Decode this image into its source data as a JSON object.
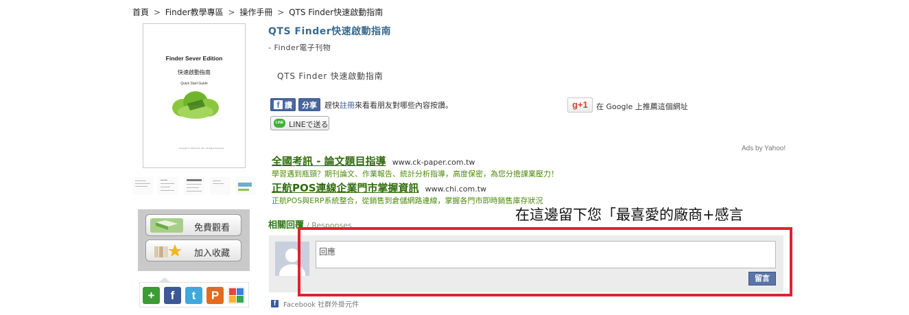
{
  "breadcrumb": {
    "items": [
      "首頁",
      "Finder教學專區",
      "操作手冊",
      "QTS Finder快速啟動指南"
    ],
    "separator": ">"
  },
  "cover": {
    "title": "Finder Sever Edition",
    "subtitle": "快速啟動指南",
    "guide": "Quick Start Guide",
    "footer": "Copyright © 2009 QTS, INC. All Rights Reserved."
  },
  "actions": {
    "free_view": "免費觀看",
    "add_favorite": "加入收藏"
  },
  "share_icons": [
    "add-icon",
    "facebook-icon",
    "twitter-icon",
    "plurk-icon",
    "google-bookmark-icon"
  ],
  "book": {
    "title": "QTS Finder快速啟動指南",
    "subtitle": "- Finder電子刊物",
    "description": "QTS Finder 快速啟動指南"
  },
  "facebook": {
    "like_label": "讚",
    "share_label": "分享",
    "prompt_prefix": "趕快",
    "prompt_link": "註冊",
    "prompt_suffix": "來看看朋友對哪些內容按讚。"
  },
  "line": {
    "label": "LINEで送る",
    "logo_text": "LINE"
  },
  "gplus": {
    "label": "g+1",
    "text": "在 Google 上推薦這個網址"
  },
  "ads": {
    "by": "Ads by Yahoo!",
    "items": [
      {
        "title": "全國考訊 - 論文題目指導",
        "url": "www.ck-paper.com.tw",
        "desc": "學習遇到瓶頸？期刊論文、作業報告、統計分析指導，高度保密，為您分擔課業壓力！"
      },
      {
        "title": "正航POS連線企業門市掌握資訊",
        "url": "www.chi.com.tw",
        "desc": "正航POS與ERP系統整合，從銷售到倉儲網路連線，掌握各門市即時銷售庫存狀況"
      }
    ]
  },
  "responses": {
    "heading": "相關回覆",
    "sub": "/ Responses",
    "overlay_note": "在這邊留下您「最喜愛的廠商+感言",
    "input_placeholder": "回應",
    "post_label": "留言",
    "plugin_text": "Facebook 社群外掛元件"
  },
  "colors": {
    "title_blue": "#3a6a8e",
    "ad_green": "#2f6b0b",
    "highlight_red": "#e0232b",
    "facebook_blue": "#4a66a0"
  }
}
